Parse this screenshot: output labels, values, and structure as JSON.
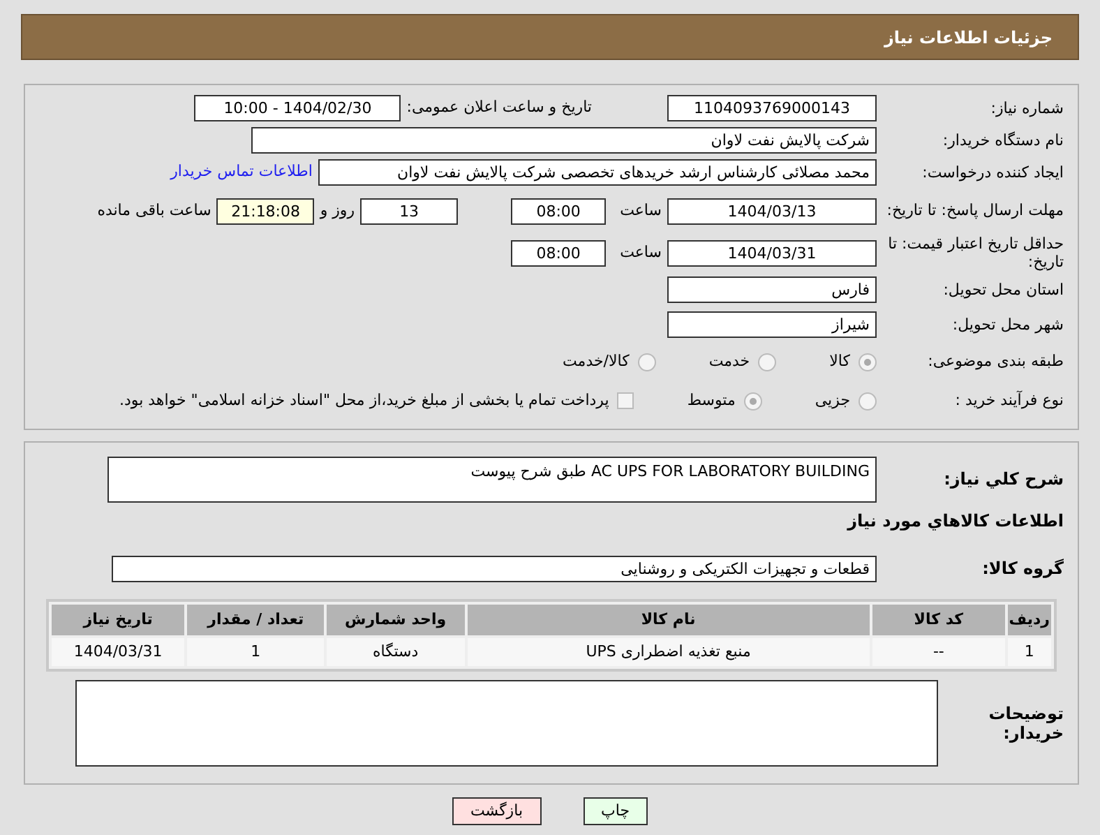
{
  "header": {
    "title": "جزئیات اطلاعات نیاز"
  },
  "need_number": {
    "label": "شماره نیاز:",
    "value": "1104093769000143"
  },
  "announce": {
    "label": "تاریخ و ساعت اعلان عمومی:",
    "value": "1404/02/30 - 10:00"
  },
  "buyer_org": {
    "label": "نام دستگاه خریدار:",
    "value": "شرکت پالایش نفت لاوان"
  },
  "requester": {
    "label": "ایجاد کننده درخواست:",
    "value": "محمد مصلائی کارشناس ارشد خریدهای تخصصی شرکت پالایش نفت لاوان",
    "link": "اطلاعات تماس خریدار"
  },
  "deadline": {
    "label": "مهلت ارسال پاسخ: تا تاریخ:",
    "date": "1404/03/13",
    "time_label": "ساعت",
    "time": "08:00",
    "days": "13",
    "days_label": "روز و",
    "remaining": "21:18:08",
    "remaining_label": "ساعت باقی مانده"
  },
  "price_validity": {
    "label": "حداقل تاریخ اعتبار قیمت: تا تاریخ:",
    "date": "1404/03/31",
    "time_label": "ساعت",
    "time": "08:00"
  },
  "province": {
    "label": "استان محل تحویل:",
    "value": "فارس"
  },
  "city": {
    "label": "شهر محل تحویل:",
    "value": "شیراز"
  },
  "category": {
    "label": "طبقه بندی موضوعی:",
    "options": [
      {
        "label": "کالا",
        "selected": true
      },
      {
        "label": "خدمت",
        "selected": false
      },
      {
        "label": "کالا/خدمت",
        "selected": false
      }
    ]
  },
  "process": {
    "label": "نوع فرآیند خرید :",
    "options": [
      {
        "label": "جزیی",
        "selected": false
      },
      {
        "label": "متوسط",
        "selected": true
      }
    ],
    "payment": {
      "label": "پرداخت تمام یا بخشی از مبلغ خرید،از محل \"اسناد خزانه اسلامی\" خواهد بود.",
      "checked": false
    }
  },
  "description": {
    "label": "شرح کلي نیاز:",
    "value": "AC UPS FOR LABORATORY BUILDING طبق شرح پیوست"
  },
  "goods_heading": "اطلاعات کالاهاي مورد نیاز",
  "goods_group": {
    "label": "گروه کالا:",
    "value": "قطعات و تجهیزات الکتریکی و روشنایی"
  },
  "table": {
    "columns": [
      "ردیف",
      "کد کالا",
      "نام کالا",
      "واحد شمارش",
      "تعداد / مقدار",
      "تاریخ نیاز"
    ],
    "rows": [
      [
        "1",
        "--",
        "منبع تغذیه اضطراری UPS",
        "دستگاه",
        "1",
        "1404/03/31"
      ]
    ]
  },
  "buyer_notes": {
    "label": "توضیحات خریدار:"
  },
  "buttons": [
    {
      "label": "چاپ",
      "kind": "print"
    },
    {
      "label": "بازگشت",
      "kind": "back"
    }
  ]
}
